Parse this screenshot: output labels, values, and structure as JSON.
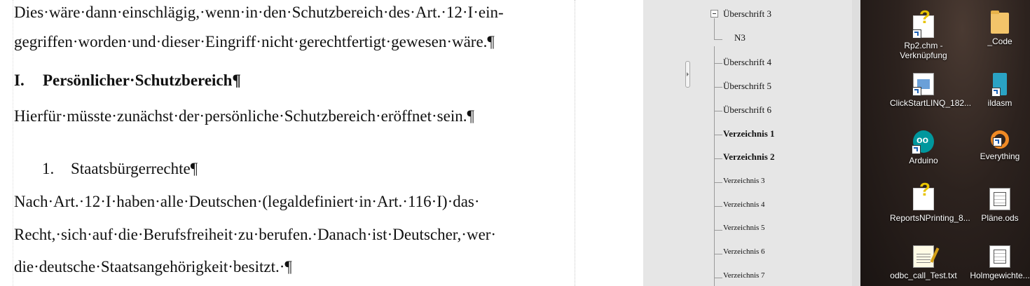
{
  "document": {
    "lines": [
      "Dies·wäre·dann·einschlägig,·wenn·in·den·Schutzbereich·des·Art.·12·I·ein-",
      "gegriffen·worden·und·dieser·Eingriff·nicht·gerechtfertigt·gewesen·wäre.¶",
      "Hierfür·müsste·zunächst·der·persönliche·Schutzbereich·eröffnet·sein.¶",
      "Nach·Art.·12·I·haben·alle·Deutschen·(legaldefiniert·in·Art.·116·I)·das·",
      "Recht,·sich·auf·die·Berufsfreiheit·zu·berufen.·Danach·ist·Deutscher,·wer·",
      "die·deutsche·Staatsangehörigkeit·besitzt.·¶"
    ],
    "heading1": {
      "number": "I.",
      "text": "Persönlicher·Schutzbereich¶"
    },
    "list_item": {
      "number": "1.",
      "text": "Staatsbürgerrechte¶"
    }
  },
  "navigator": {
    "items": [
      {
        "label": "Überschrift 3",
        "style": "normal"
      },
      {
        "label": "N3",
        "style": "normal"
      },
      {
        "label": "Überschrift 4",
        "style": "normal"
      },
      {
        "label": "Überschrift 5",
        "style": "normal"
      },
      {
        "label": "Überschrift 6",
        "style": "normal"
      },
      {
        "label": "Verzeichnis 1",
        "style": "bold"
      },
      {
        "label": "Verzeichnis 2",
        "style": "bold"
      },
      {
        "label": "Verzeichnis 3",
        "style": "small"
      },
      {
        "label": "Verzeichnis 4",
        "style": "small"
      },
      {
        "label": "Verzeichnis 5",
        "style": "small"
      },
      {
        "label": "Verzeichnis 6",
        "style": "small"
      },
      {
        "label": "Verzeichnis 7",
        "style": "small"
      }
    ]
  },
  "desktop": {
    "icons": [
      {
        "label": "Rp2.chm - Verknüpfung",
        "icon": "help-file-icon"
      },
      {
        "label": "_Code",
        "icon": "folder-icon"
      },
      {
        "label": "ClickStartLINQ_182...",
        "icon": "document-icon"
      },
      {
        "label": "ildasm",
        "icon": "ildasm-icon"
      },
      {
        "label": "Arduino",
        "icon": "arduino-icon"
      },
      {
        "label": "Everything",
        "icon": "everything-icon"
      },
      {
        "label": "ReportsNPrinting_8...",
        "icon": "help-file-icon"
      },
      {
        "label": "Pläne.ods",
        "icon": "spreadsheet-icon"
      },
      {
        "label": "odbc_call_Test.txt",
        "icon": "text-file-icon"
      },
      {
        "label": "Holmgewichte...",
        "icon": "spreadsheet-icon"
      }
    ]
  }
}
